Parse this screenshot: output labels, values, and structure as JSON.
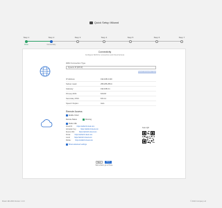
{
  "header": {
    "title": "Quick Setup Wizard"
  },
  "steps": [
    {
      "label": "Step 1",
      "sub": "Done",
      "state": "done"
    },
    {
      "label": "Step 2",
      "sub": "Connectivity",
      "state": "current"
    },
    {
      "label": "Step 3",
      "sub": "",
      "state": "todo"
    },
    {
      "label": "Step 4",
      "sub": "",
      "state": "todo"
    },
    {
      "label": "Step 5",
      "sub": "",
      "state": "todo"
    },
    {
      "label": "Step 6",
      "sub": "",
      "state": "todo"
    },
    {
      "label": "Step 7",
      "sub": "",
      "state": "todo"
    }
  ],
  "connectivity": {
    "title": "Connectivity",
    "subtitle": "Configure WAN for connection and Cloud Access",
    "wan_type_label": "WAN Connection Type",
    "wan_type_value": "Dynamic IP (DHCP)",
    "action_button": "Detect Connection Type",
    "fields": [
      {
        "key": "IP Address:",
        "value": "192.168.0.100"
      },
      {
        "key": "Subnet mask:",
        "value": "255.255.255.0"
      },
      {
        "key": "Gateway:",
        "value": "192.168.0.1"
      },
      {
        "key": "Primary DNS:",
        "value": "8.8.8.8"
      },
      {
        "key": "Secondary DNS:",
        "value": "8.8.4.4"
      },
      {
        "key": "Speed / Duplex:",
        "value": "Auto"
      }
    ]
  },
  "cloud": {
    "title": "Remote Access",
    "enable_label": "Enable Cloud",
    "remote_label": "Remote Status",
    "remote_value": "Running",
    "public_label": "Public URL",
    "qr_caption": "Scan QR",
    "info": [
      {
        "key": "Cloud ID:",
        "value": "https://a1b2c3.cloud.com"
      },
      {
        "key": "Activation Key:",
        "value": "https://a1b2c3.cloud.com"
      },
      {
        "key": "Device URL:",
        "value": "https://a1b2c3.cloud.com"
      },
      {
        "key": "Portal:",
        "value": "https://a1b2c3.cloud.com"
      },
      {
        "key": "Local:",
        "value": "https://a1b2c3.cloud.com"
      },
      {
        "key": "Mobile:",
        "value": "https://a1b2c3.cloud.com"
      }
    ],
    "check_label": "Show advanced settings"
  },
  "nav": {
    "back": "Back",
    "next": "Next",
    "skip": "Skip wizard, go to Home"
  },
  "footer": {
    "left": "Model: ER-2000  Version: 1.0.0",
    "right": "© 2024 Company Ltd"
  },
  "colors": {
    "accent": "#2c6fcf",
    "done": "#2aa066"
  }
}
